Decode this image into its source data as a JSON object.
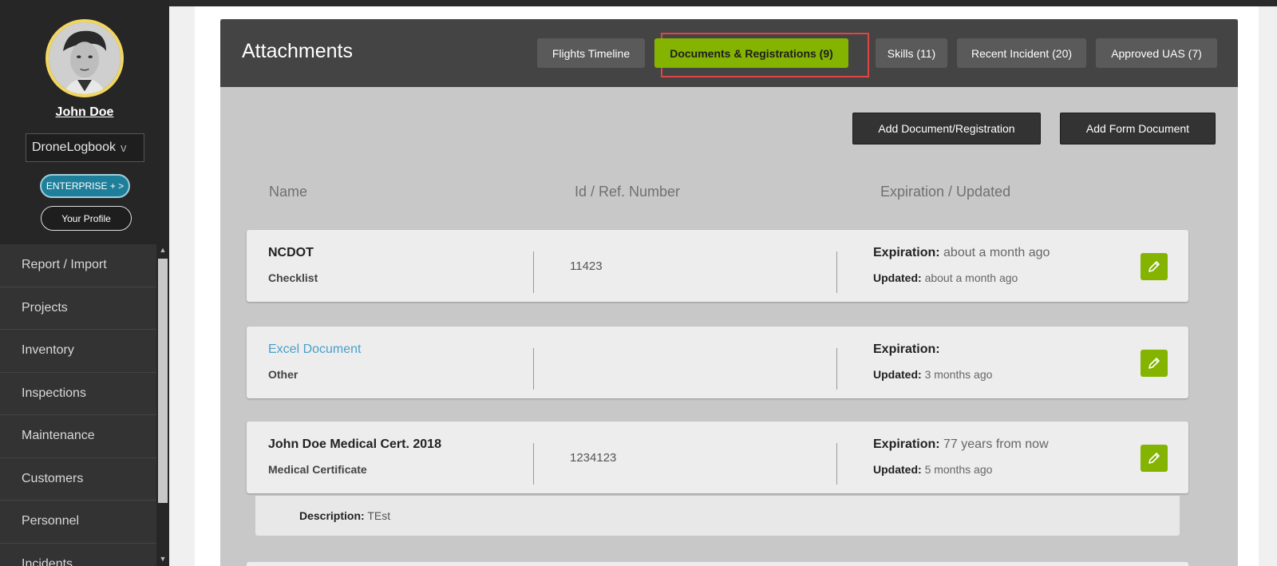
{
  "sidebar": {
    "user_name": "John Doe",
    "org": "DroneLogbook",
    "org_chevron": "v",
    "enterprise_label": "ENTERPRISE + >",
    "profile_label": "Your Profile",
    "nav": [
      "Report / Import",
      "Projects",
      "Inventory",
      "Inspections",
      "Maintenance",
      "Customers",
      "Personnel",
      "Incidents"
    ]
  },
  "panel": {
    "title": "Attachments",
    "tabs": [
      {
        "label": "Flights Timeline",
        "active": false
      },
      {
        "label": "Documents & Registrations (9)",
        "active": true
      },
      {
        "label": "Skills (11)",
        "active": false
      },
      {
        "label": "Recent Incident (20)",
        "active": false
      },
      {
        "label": "Approved UAS (7)",
        "active": false
      }
    ],
    "add_document_label": "Add Document/Registration",
    "add_form_label": "Add Form Document",
    "columns": [
      "Name",
      "Id / Ref. Number",
      "Expiration / Updated"
    ]
  },
  "documents": [
    {
      "name": "NCDOT",
      "type": "Checklist",
      "ref": "11423",
      "expiration_label": "Expiration:",
      "expiration": "about a month ago",
      "updated_label": "Updated:",
      "updated": "about a month ago"
    },
    {
      "name": "Excel Document",
      "type": "Other",
      "ref": "",
      "expiration_label": "Expiration:",
      "expiration": "",
      "updated_label": "Updated:",
      "updated": "3 months ago"
    },
    {
      "name": "John Doe Medical Cert. 2018",
      "type": "Medical Certificate",
      "ref": "1234123",
      "expiration_label": "Expiration:",
      "expiration": "77 years from now",
      "updated_label": "Updated:",
      "updated": "5 months ago",
      "description_label": "Description:",
      "description": "TEst"
    }
  ],
  "colors": {
    "accent_green": "#84b300",
    "link_blue": "#4aa0c9",
    "highlight_red": "#e04545",
    "enterprise_teal": "#1f7f9a"
  },
  "icons": {
    "edit": "pencil-icon",
    "scroll_up": "arrow-up-icon",
    "scroll_down": "arrow-down-icon"
  }
}
